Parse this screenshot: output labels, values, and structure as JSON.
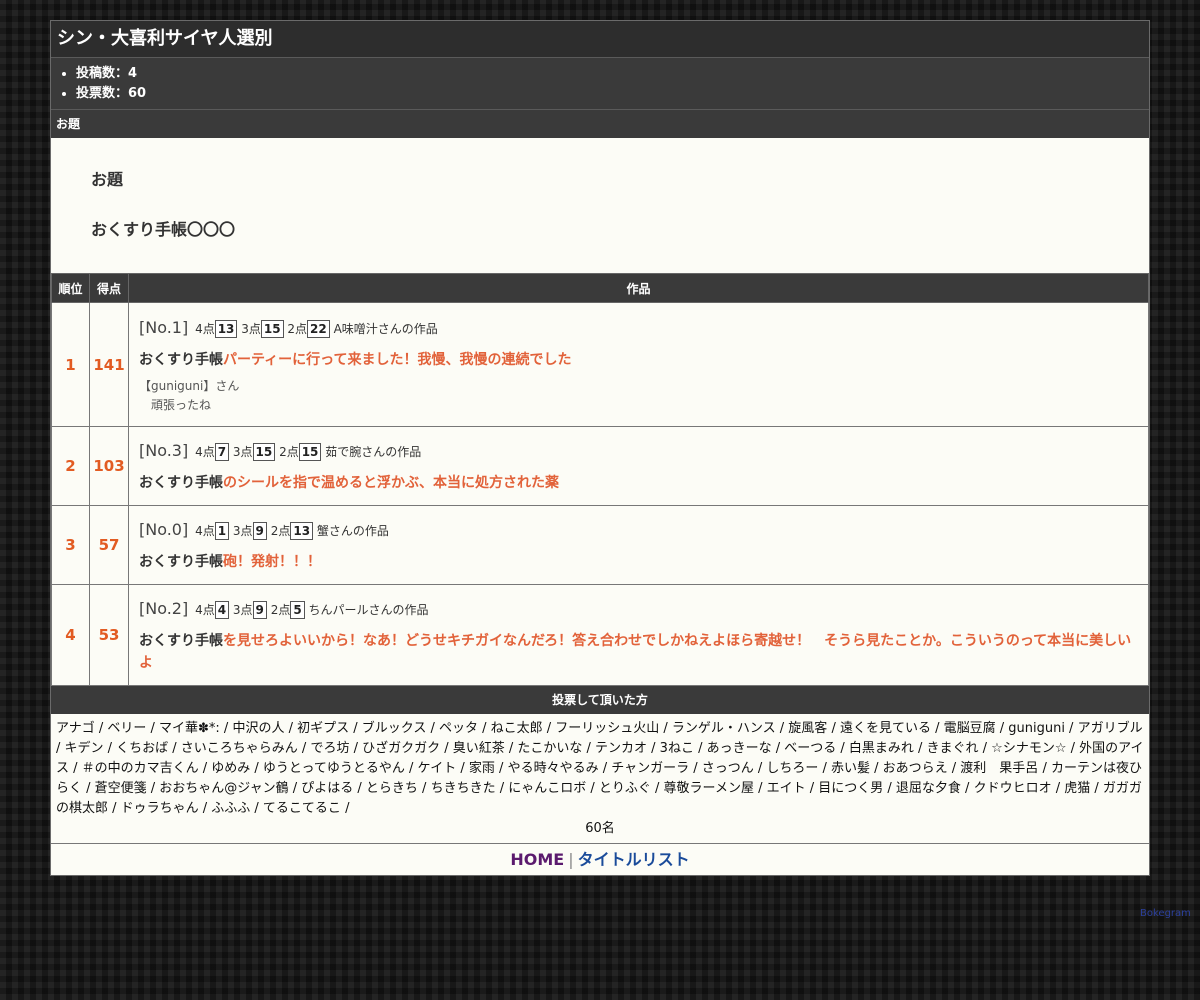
{
  "page": {
    "title": "シン・大喜利サイヤ人選別",
    "stats": [
      "投稿数：4",
      "投票数：60"
    ],
    "odai_section_label": "お題",
    "odai_heading": "お題",
    "odai_text": "おくすり手帳〇〇〇"
  },
  "table": {
    "headers": {
      "rank": "順位",
      "score": "得点",
      "work": "作品"
    },
    "rows": [
      {
        "rank": "1",
        "score": "141",
        "no": "[No.1]",
        "p4": "4点",
        "p4v": "13",
        "p3": "3点",
        "p3v": "15",
        "p2": "2点",
        "p2v": "22",
        "author": "A味噌汁さんの作品",
        "prefix": "おくすり手帳",
        "answer": "パーティーに行って来ました！我慢、我慢の連続でした",
        "comment_from": "【guniguni】さん",
        "comment_text": "頑張ったね"
      },
      {
        "rank": "2",
        "score": "103",
        "no": "[No.3]",
        "p4": "4点",
        "p4v": "7",
        "p3": "3点",
        "p3v": "15",
        "p2": "2点",
        "p2v": "15",
        "author": "茹で腕さんの作品",
        "prefix": "おくすり手帳",
        "answer": "のシールを指で温めると浮かぶ、本当に処方された薬"
      },
      {
        "rank": "3",
        "score": "57",
        "no": "[No.0]",
        "p4": "4点",
        "p4v": "1",
        "p3": "3点",
        "p3v": "9",
        "p2": "2点",
        "p2v": "13",
        "author": "蟹さんの作品",
        "prefix": "おくすり手帳",
        "answer": "砲！発射！！！"
      },
      {
        "rank": "4",
        "score": "53",
        "no": "[No.2]",
        "p4": "4点",
        "p4v": "4",
        "p3": "3点",
        "p3v": "9",
        "p2": "2点",
        "p2v": "5",
        "author": "ちんパールさんの作品",
        "prefix": "おくすり手帳",
        "answer": "を見せろよいいから！なあ！どうせキチガイなんだろ！答え合わせでしかねえよほら寄越せ！　そうら見たことか。こういうのって本当に美しいよ"
      }
    ]
  },
  "voters": {
    "heading": "投票して頂いた方",
    "list": "アナゴ / ベリー / マイ華✽*: / 中沢の人 / 初ギプス / ブルックス / ペッタ / ねこ太郎 / フーリッシュ火山 / ランゲル・ハンス / 旋風客 / 遠くを見ている / 電脳豆腐 / guniguni / アガリブル / キデン / くちおば / さいころちゃらみん / でろ坊 / ひざガクガク / 臭い紅茶 / たこかいな / テンカオ / 3ねこ / あっきーな / べーつる / 白黒まみれ / きまぐれ / ☆シナモン☆ / 外国のアイス / ＃の中のカマ吉くん / ゆめみ / ゆうとってゆうとるやん / ケイト / 家雨 / やる時々やるみ / チャンガーラ / さっつん / しちろー / 赤い髪 / おあつらえ / 渡利　果手呂 / カーテンは夜ひらく / 蒼空便箋 / おおちゃん@ジャン鶴 / ぴよはる / とらきち / ちきちきた / にゃんこロボ / とりふぐ / 尊敬ラーメン屋 / エイト / 目につく男 / 退屈な夕食 / クドウヒロオ / 虎猫 / ガガガの棋太郎 / ドゥラちゃん / ふふふ / てるこてるこ /",
    "count": "60名"
  },
  "footer": {
    "home": "HOME",
    "separator": "|",
    "title_list": "タイトルリスト"
  },
  "credit": "Bokegram"
}
